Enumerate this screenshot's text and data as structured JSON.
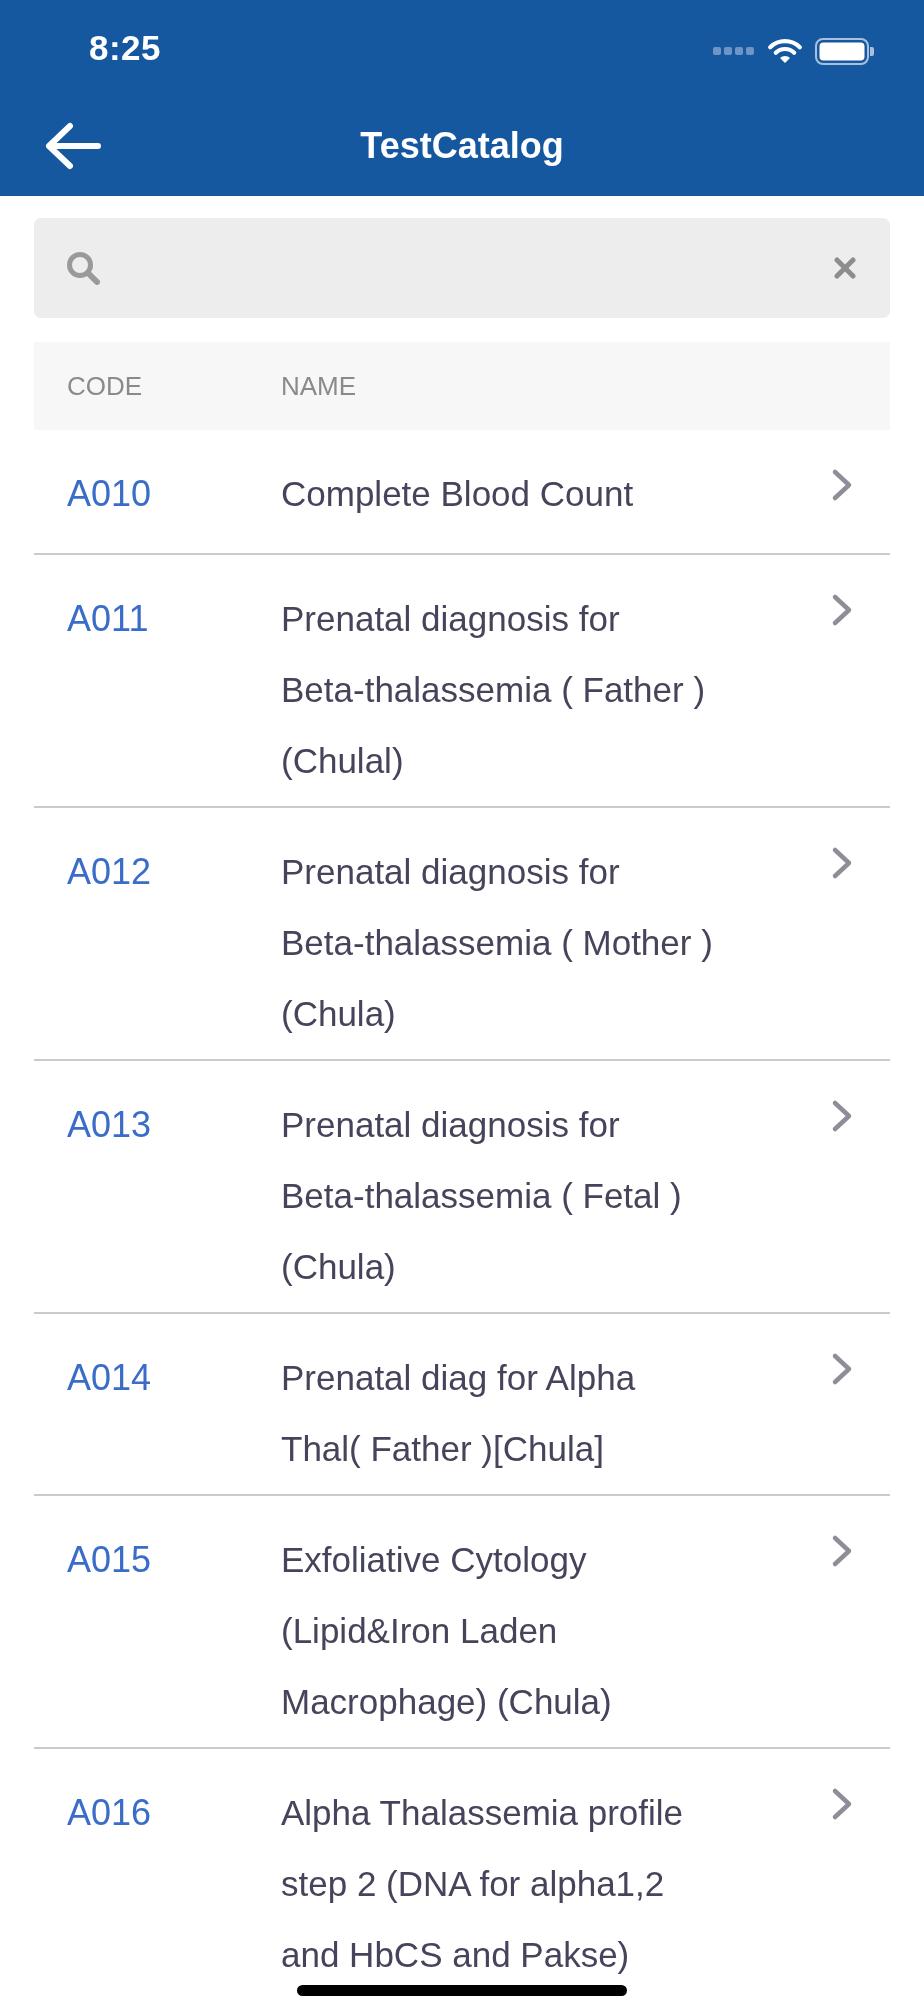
{
  "status_bar": {
    "time": "8:25"
  },
  "nav_bar": {
    "title": "TestCatalog"
  },
  "table": {
    "columns": [
      "CODE",
      "NAME"
    ],
    "rows": [
      {
        "code": "A010",
        "name": "Complete Blood Count"
      },
      {
        "code": "A011",
        "name": "Prenatal diagnosis for\nBeta-thalassemia ( Father )\n(Chulal)"
      },
      {
        "code": "A012",
        "name": "Prenatal diagnosis for\nBeta-thalassemia ( Mother )\n(Chula)"
      },
      {
        "code": "A013",
        "name": "Prenatal diagnosis for\nBeta-thalassemia ( Fetal )\n(Chula)"
      },
      {
        "code": "A014",
        "name": "Prenatal diag for Alpha\nThal( Father )[Chula]"
      },
      {
        "code": "A015",
        "name": "Exfoliative Cytology\n(Lipid&Iron Laden\nMacrophage) (Chula)"
      },
      {
        "code": "A016",
        "name": "Alpha Thalassemia profile\nstep 2 (DNA for alpha1,2\nand HbCS and Pakse)"
      }
    ]
  }
}
